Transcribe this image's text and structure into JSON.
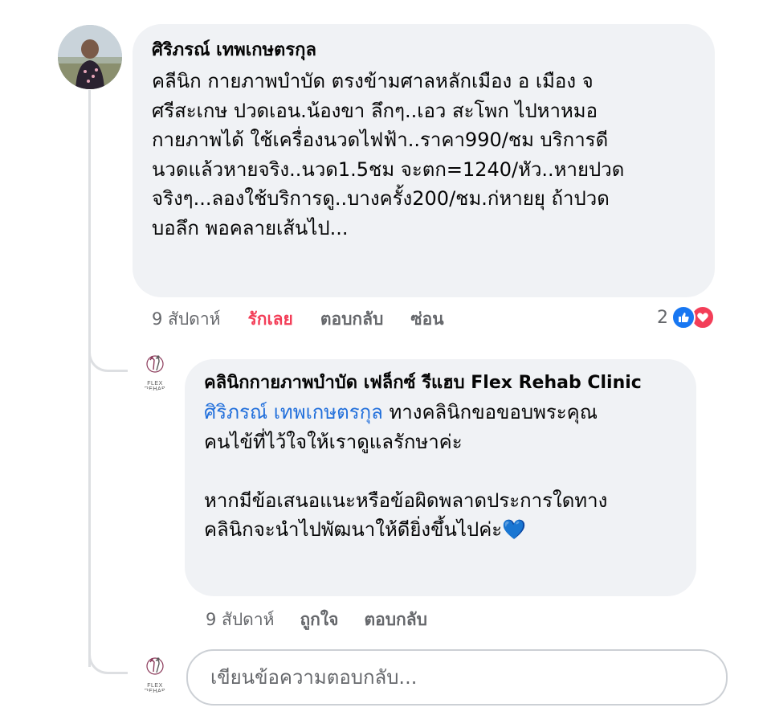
{
  "comment": {
    "author": "ศิริภรณ์ เทพเกษตรกุล",
    "lines": [
      "คลีนิก กายภาพบำบัด ตรงข้ามศาลหลักเมือง อ เมือง จ",
      "ศรีสะเกษ ปวดเอน.น้องขา ลึกๆ..เอว สะโพก ไปหาหมอ",
      "กายภาพได้ ใช้เครื่องนวดไฟฟ้า..ราคา990/ชม บริการดี",
      "นวดแล้วหายจริง..นวด1.5ชม จะตก=1240/หัว..หายปวด",
      "จริงๆ...ลองใช้บริการดู..บางครั้ง200/ชม.ก่หายยุ ถ้าปวด",
      "บอลึก พอคลายเส้นไป..."
    ],
    "time": "9 สัปดาห์",
    "like_label": "รักเลย",
    "reply_label": "ตอบกลับ",
    "hide_label": "ซ่อน",
    "reaction_count": "2",
    "colors": {
      "like": "#1877f2",
      "love": "#f33e58",
      "liked_text": "#f33e58"
    }
  },
  "reply": {
    "author": "คลินิกกายภาพบำบัด เฟล็กซ์ รีแฮบ Flex Rehab Clinic",
    "logo_text": "FLEX REHAB",
    "mention": "ศิริภรณ์ เทพเกษตรกุล",
    "line1_rest": " ทางคลินิกขอขอบพระคุณ",
    "line2": "คนไข้ที่ไว้ใจให้เราดูแลรักษาค่ะ",
    "line3": "หากมีข้อเสนอแนะหรือข้อผิดพลาดประการใดทาง",
    "line4": "คลินิกจะนำไปพัฒนาให้ดียิ่งขึ้นไปค่ะ",
    "emoji": "💙",
    "time": "9 สัปดาห์",
    "like_label": "ถูกใจ",
    "reply_label": "ตอบกลับ"
  },
  "composer": {
    "logo_text": "FLEX REHAB",
    "placeholder": "เขียนข้อความตอบกลับ..."
  }
}
